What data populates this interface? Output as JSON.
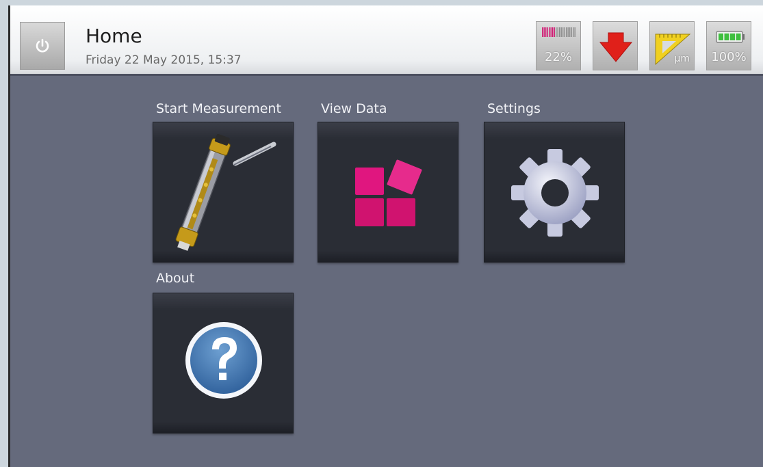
{
  "header": {
    "title": "Home",
    "datetime": "Friday 22 May 2015, 15:37"
  },
  "status": {
    "storage_percent": "22%",
    "battery_percent": "100%",
    "unit_label": "µm"
  },
  "tiles": [
    {
      "label": "Start Measurement",
      "icon": "probe-icon"
    },
    {
      "label": "View Data",
      "icon": "data-blocks-icon"
    },
    {
      "label": "Settings",
      "icon": "gear-icon"
    },
    {
      "label": "About",
      "icon": "help-icon"
    }
  ],
  "colors": {
    "screen_bg": "#656a7c",
    "tile_bg": "#2a2d35",
    "accent_magenta": "#e0167f",
    "arrow_red": "#e0201a",
    "battery_green": "#3fbf3f"
  }
}
